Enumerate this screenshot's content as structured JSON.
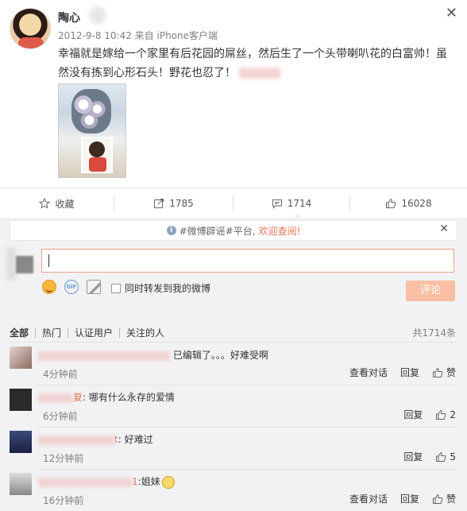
{
  "post": {
    "author": "陶心",
    "meta": "2012-9-8 10:42 来自 iPhone客户端",
    "content": "幸福就是嫁给一个家里有后花园的屌丝，然后生了一个头带喇叭花的白富帅！虽然没有拣到心形石头！野花也忍了！",
    "close_symbol": "✕"
  },
  "actions": {
    "favorite": "收藏",
    "repost_count": "1785",
    "comment_count": "1714",
    "like_count": "16028"
  },
  "notice": {
    "text": "#微博辟谣#平台,",
    "welcome": "欢迎查阅!",
    "close_symbol": "✕"
  },
  "reply": {
    "repost_label": "同时转发到我的微博",
    "submit_label": "评论"
  },
  "filters": {
    "items": [
      "全部",
      "热门",
      "认证用户",
      "关注的人"
    ],
    "total": "共1714条"
  },
  "comments": [
    {
      "text": "已编辑了。。。好难受啊",
      "time": "4分钟前",
      "view_thread": "查看对话",
      "reply": "回复",
      "like": "赞"
    },
    {
      "prefix": "复",
      "text": "哪有什么永存的爱情",
      "time": "6分钟前",
      "reply": "回复",
      "likes": "2"
    },
    {
      "prefix": "t",
      "text": "好难过",
      "time": "12分钟前",
      "reply": "回复",
      "likes": "5"
    },
    {
      "prefix": "1",
      "text": "姐妹",
      "time": "16分钟前",
      "view_thread": "查看对话",
      "reply": "回复",
      "like": "赞"
    }
  ],
  "colors": {
    "accent": "#eb7350",
    "submit_disabled": "#fbbfa5",
    "panel_bg": "#f2f2f5",
    "meta_gray": "#808080"
  }
}
